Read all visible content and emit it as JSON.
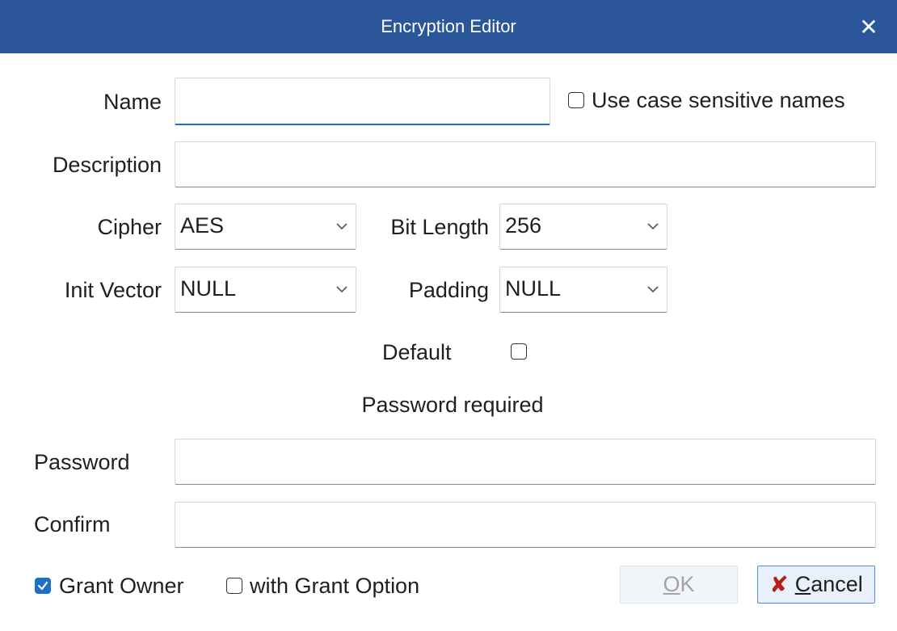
{
  "window": {
    "title": "Encryption Editor"
  },
  "name": {
    "label": "Name",
    "value": ""
  },
  "case_sensitive": {
    "label": "Use case sensitive names",
    "checked": false
  },
  "description": {
    "label": "Description",
    "value": ""
  },
  "cipher": {
    "label": "Cipher",
    "value": "AES"
  },
  "bit_length": {
    "label": "Bit Length",
    "value": "256"
  },
  "init_vector": {
    "label": "Init Vector",
    "value": "NULL"
  },
  "padding": {
    "label": "Padding",
    "value": "NULL"
  },
  "default": {
    "label": "Default",
    "checked": false
  },
  "password_required": "Password required",
  "password": {
    "label": "Password",
    "value": ""
  },
  "confirm": {
    "label": "Confirm",
    "value": ""
  },
  "grant_owner": {
    "label": "Grant Owner",
    "checked": true
  },
  "grant_option": {
    "label": "with Grant Option",
    "checked": false
  },
  "buttons": {
    "ok": {
      "mnemonic": "O",
      "rest": "K",
      "enabled": false
    },
    "cancel": {
      "mnemonic": "C",
      "rest": "ancel"
    }
  },
  "icons": {
    "close": "close-icon",
    "cancel": "x-mark-icon",
    "chevron": "chevron-down-icon",
    "check": "checkmark-icon"
  },
  "colors": {
    "title_bar": "#2b579a",
    "focus_underline": "#1e6fc9",
    "checkbox_checked": "#1e6fc9",
    "cancel_icon": "#b71c1c",
    "ok_disabled_text": "#a3a3a3"
  }
}
